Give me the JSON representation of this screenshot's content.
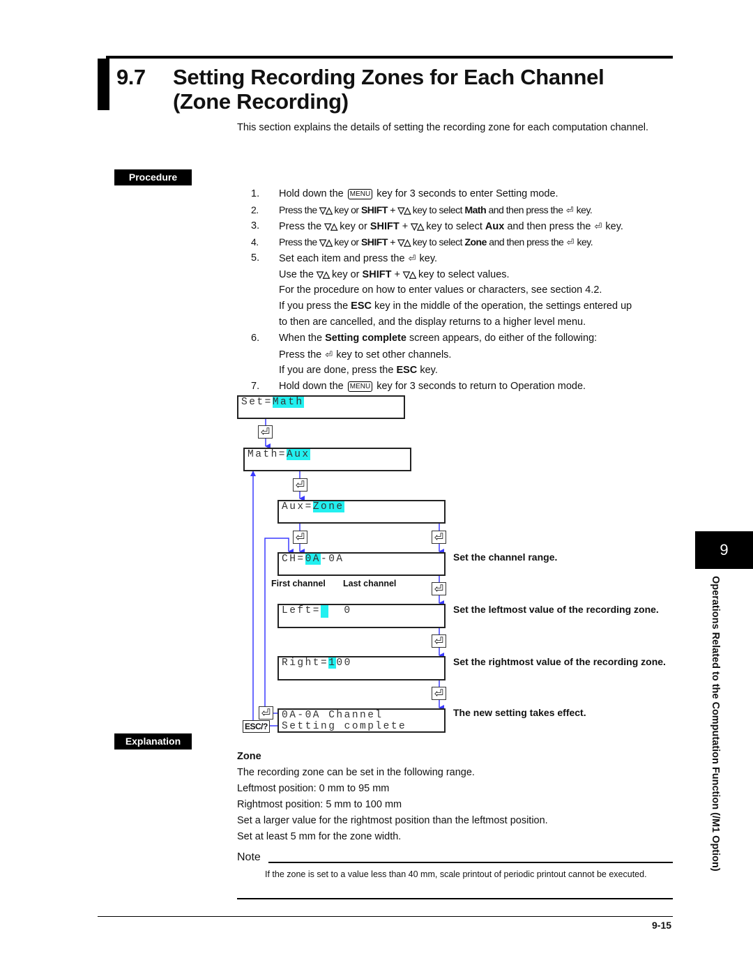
{
  "header": {
    "section_number": "9.7",
    "title_line1": "Setting Recording Zones for Each Channel",
    "title_line2": "(Zone Recording)",
    "intro": "This section explains the details of setting the recording zone for each computation channel."
  },
  "procedure": {
    "tag": "Procedure",
    "steps": [
      {
        "num": "1.",
        "parts": [
          "Hold down the ",
          "MENU",
          " key for 3 seconds to enter Setting mode."
        ]
      },
      {
        "num": "2.",
        "parts": [
          "Press the ",
          " key or ",
          "SHIFT",
          " + ",
          " key to select ",
          "Math",
          " and then press the ",
          " key."
        ]
      },
      {
        "num": "3.",
        "parts": [
          "Press the ",
          " key or ",
          "SHIFT",
          " + ",
          " key to select ",
          "Aux",
          " and then press the ",
          " key."
        ]
      },
      {
        "num": "4.",
        "parts": [
          "Press the ",
          " key or ",
          "SHIFT",
          " + ",
          " key to select ",
          "Zone",
          " and then press the ",
          " key."
        ]
      },
      {
        "num": "5.",
        "parts": [
          "Set each item and press the ",
          " key."
        ]
      },
      {
        "num": "",
        "parts": [
          "Use the ",
          " key or ",
          "SHIFT",
          " + ",
          " key to select values."
        ]
      },
      {
        "num": "",
        "parts": [
          "For the procedure on how to enter values or characters, see section 4.2."
        ]
      },
      {
        "num": "",
        "parts": [
          "If you press the ",
          "ESC",
          " key in the middle of the operation, the settings entered up"
        ]
      },
      {
        "num": "",
        "parts": [
          "to then are cancelled, and the display returns to a higher level menu."
        ]
      },
      {
        "num": "6.",
        "parts": [
          "When the ",
          "Setting complete",
          " screen appears, do either of the following:"
        ]
      },
      {
        "num": "",
        "parts": [
          "Press the ",
          " key to set other channels."
        ]
      },
      {
        "num": "",
        "parts": [
          "If you are done, press the ",
          "ESC",
          " key."
        ]
      },
      {
        "num": "7.",
        "parts": [
          "Hold down the ",
          "MENU",
          " key for 3 seconds to return to Operation mode."
        ]
      }
    ]
  },
  "icons": {
    "menu_key": "MENU",
    "updown_key": "▽△",
    "enter_key": "⏎",
    "esc_key": "ESC/?"
  },
  "diagram": {
    "screens": [
      {
        "id": "set",
        "prefix": "Set=",
        "highlight": "Math",
        "suffix": ""
      },
      {
        "id": "math",
        "prefix": "Math=",
        "highlight": "Aux",
        "suffix": ""
      },
      {
        "id": "aux",
        "prefix": "Aux=",
        "highlight": "Zone",
        "suffix": ""
      },
      {
        "id": "ch",
        "prefix": "CH=",
        "highlight": "0A",
        "suffix": "-0A"
      },
      {
        "id": "left",
        "prefix": "Left=",
        "highlight": " ",
        "suffix": "  0"
      },
      {
        "id": "right",
        "prefix": "Right=",
        "highlight": "1",
        "suffix": "00"
      },
      {
        "id": "complete",
        "line1": "0A-0A Channel",
        "line2": "Setting complete"
      }
    ],
    "sublabels": {
      "first_channel": "First channel",
      "last_channel": "Last channel"
    },
    "captions": {
      "ch": "Set the channel range.",
      "left": "Set the leftmost value of the recording zone.",
      "right": "Set the rightmost value of the recording zone.",
      "complete": "The new setting takes effect."
    },
    "highlight_color": "#22f0f0",
    "arrow_color": "#3a3aff"
  },
  "explanation": {
    "tag": "Explanation",
    "heading": "Zone",
    "lines": [
      "The recording zone can be set in the following range.",
      "Leftmost position: 0 mm to 95 mm",
      "Rightmost position: 5 mm to 100 mm",
      "Set a larger value for the rightmost position than the leftmost position.",
      "Set at least 5 mm for the zone width."
    ]
  },
  "note": {
    "label": "Note",
    "text": "If the zone is set to a value less than 40 mm, scale printout of periodic printout cannot be executed."
  },
  "footer": {
    "page_number": "9-15",
    "chapter_number": "9",
    "chapter_title": "Operations Related to the Computation Function (/M1 Option)"
  }
}
